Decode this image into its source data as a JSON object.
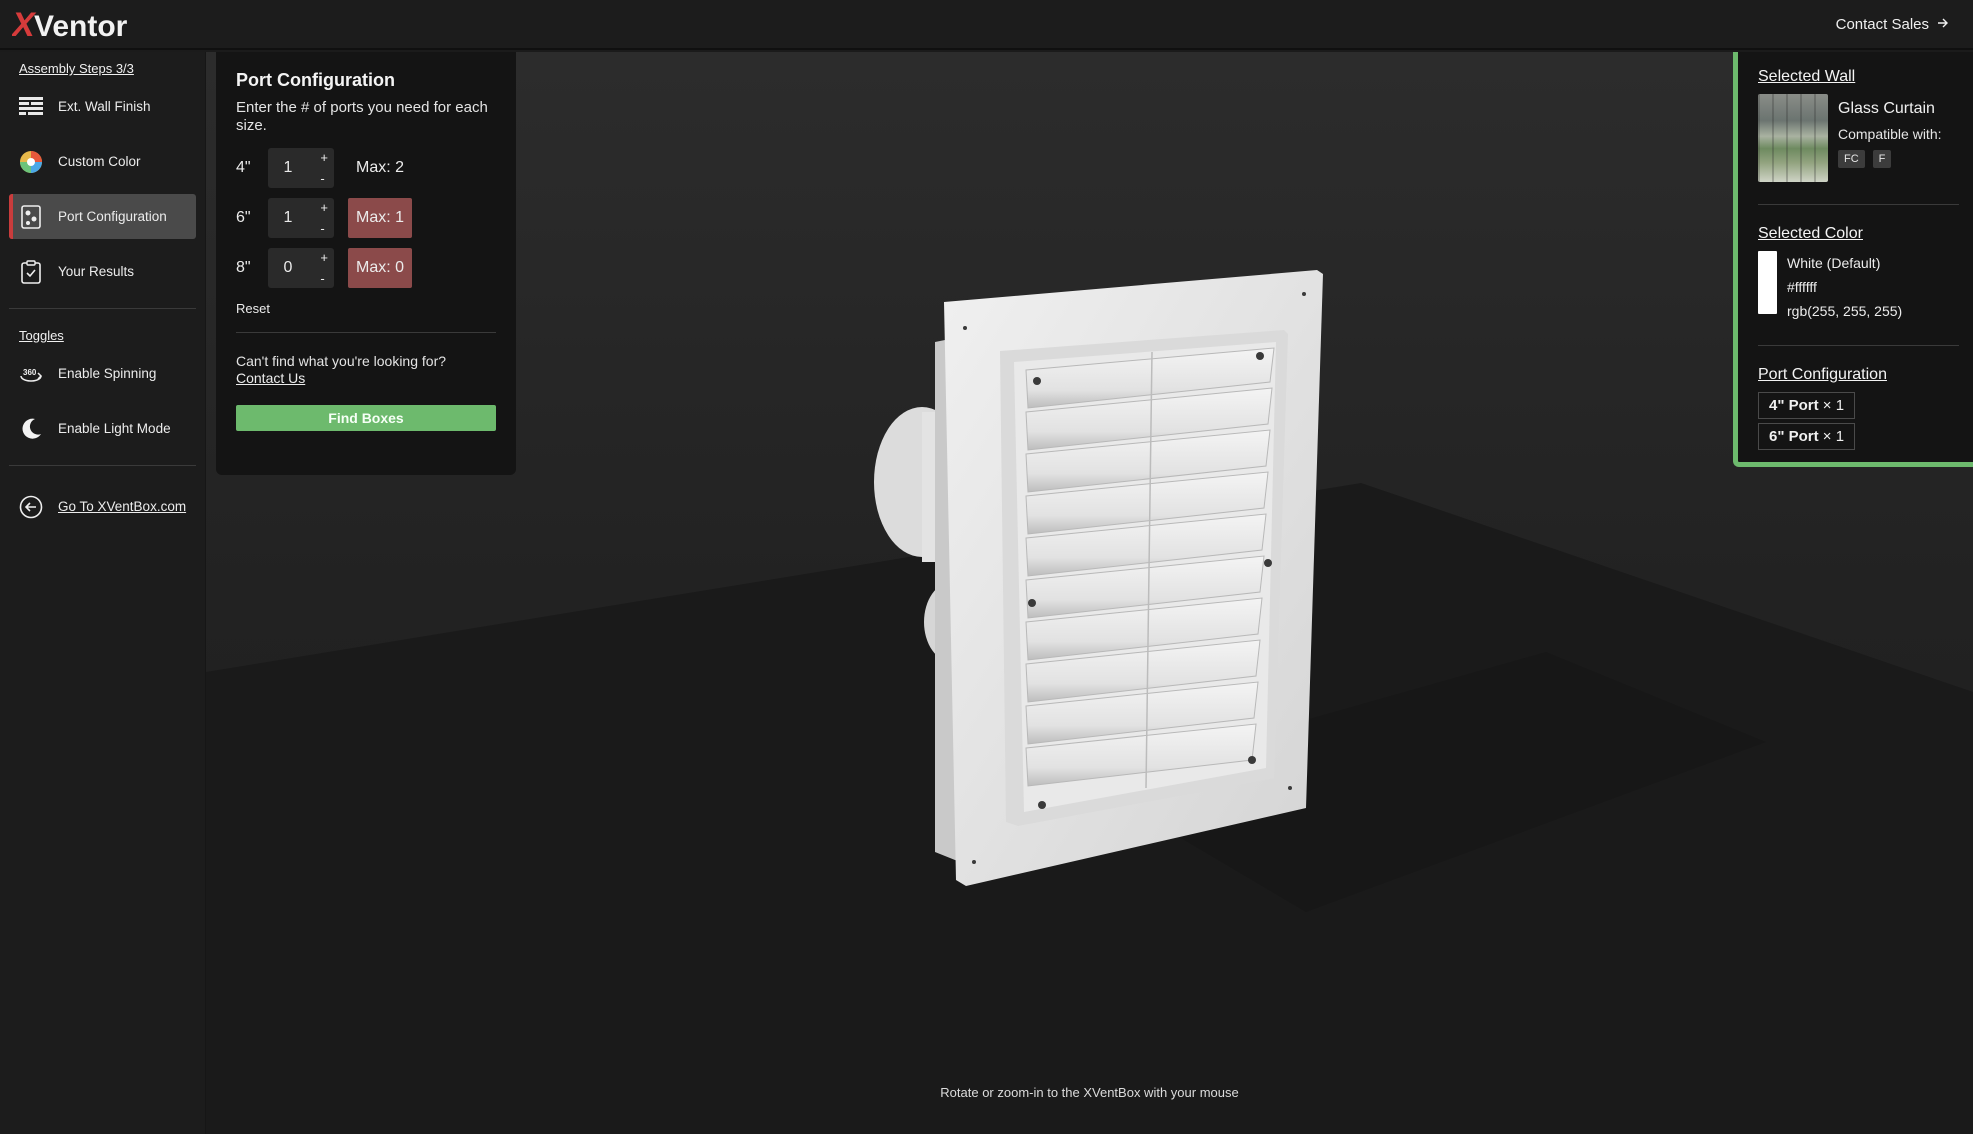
{
  "brand": {
    "name": "XVentor",
    "accent": "#d63b3b"
  },
  "topbar": {
    "contact_sales": "Contact Sales"
  },
  "sidebar": {
    "steps_title": "Assembly Steps 3/3",
    "steps": [
      {
        "label": "Ext. Wall Finish",
        "icon": "brick-wall-icon"
      },
      {
        "label": "Custom Color",
        "icon": "color-wheel-icon"
      },
      {
        "label": "Port Configuration",
        "icon": "port-config-icon",
        "active": true
      },
      {
        "label": "Your Results",
        "icon": "clipboard-icon"
      }
    ],
    "toggles_title": "Toggles",
    "toggles": [
      {
        "label": "Enable Spinning",
        "icon": "spin-360-icon"
      },
      {
        "label": "Enable Light Mode",
        "icon": "moon-icon"
      }
    ],
    "go_to_site": "Go To XVentBox.com"
  },
  "port_panel": {
    "title": "Port Configuration",
    "description": "Enter the # of ports you need for each size.",
    "rows": [
      {
        "size": "4\"",
        "value": "1",
        "max": "Max: 2",
        "over": false
      },
      {
        "size": "6\"",
        "value": "1",
        "max": "Max: 1",
        "over": true
      },
      {
        "size": "8\"",
        "value": "0",
        "max": "Max: 0",
        "over": true
      }
    ],
    "plus": "+",
    "minus": "-",
    "reset": "Reset",
    "cant_find": "Can't find what you're looking for?",
    "contact_us": "Contact Us",
    "find_boxes": "Find Boxes"
  },
  "summary": {
    "wall_title": "Selected Wall",
    "wall_name": "Glass Curtain",
    "compatible_with": "Compatible with:",
    "badges": [
      "FC",
      "F"
    ],
    "color_title": "Selected Color",
    "color_name": "White (Default)",
    "color_hex": "#ffffff",
    "color_rgb": "rgb(255, 255, 255)",
    "port_title": "Port Configuration",
    "ports": [
      {
        "label": "4\" Port",
        "qty": " × 1"
      },
      {
        "label": "6\" Port",
        "qty": " × 1"
      }
    ]
  },
  "viewport": {
    "hint": "Rotate or zoom-in to the XVentBox with your mouse"
  }
}
